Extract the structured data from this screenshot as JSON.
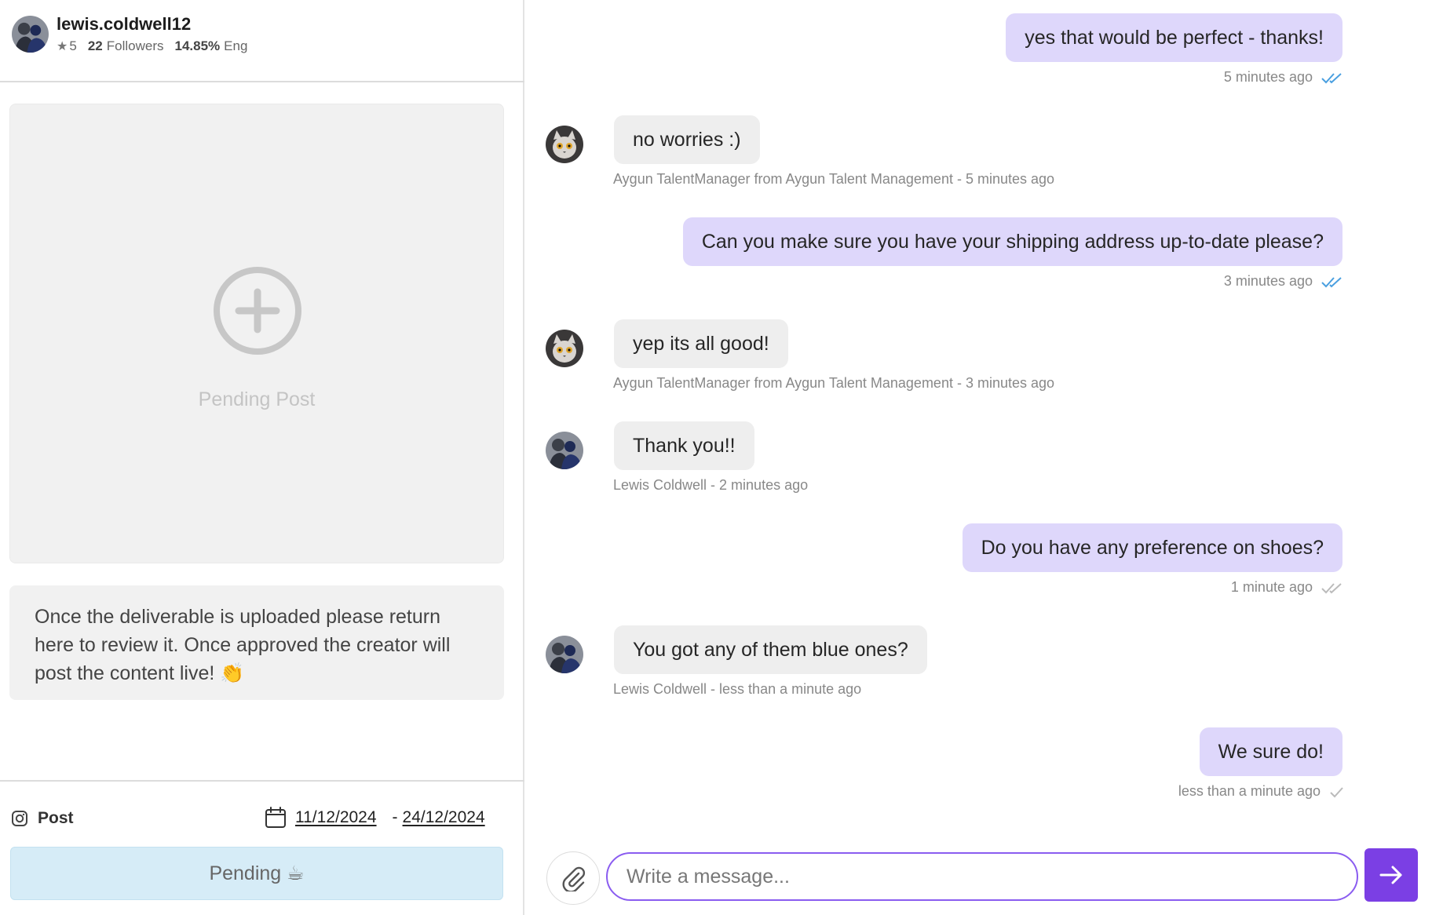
{
  "profile": {
    "username": "lewis.coldwell12",
    "rating": "5",
    "followers_count": "22",
    "followers_label": "Followers",
    "engagement_value": "14.85%",
    "engagement_label": "Eng"
  },
  "deliverable": {
    "placeholder_label": "Pending Post",
    "info_text": "Once the deliverable is uploaded please return here to review it. Once approved the creator will post the content live! 👏",
    "post_type": "Post",
    "start_date": "11/12/2024",
    "date_separator": "-",
    "end_date": "24/12/2024",
    "status_label": "Pending ☕"
  },
  "messages": [
    {
      "direction": "out",
      "text": "yes that would be perfect - thanks!",
      "meta": "5 minutes ago",
      "receipt": "read"
    },
    {
      "direction": "in",
      "text": "no worries :)",
      "meta": "Aygun TalentManager from Aygun Talent Management - 5 minutes ago",
      "avatar": "manager"
    },
    {
      "direction": "out",
      "text": "Can you make sure you have your shipping address up-to-date please?",
      "meta": "3 minutes ago",
      "receipt": "read"
    },
    {
      "direction": "in",
      "text": "yep its all good!",
      "meta": "Aygun TalentManager from Aygun Talent Management - 3 minutes ago",
      "avatar": "manager"
    },
    {
      "direction": "in",
      "text": "Thank you!!",
      "meta": "Lewis Coldwell - 2 minutes ago",
      "avatar": "creator"
    },
    {
      "direction": "out",
      "text": "Do you have any preference on shoes?",
      "meta": "1 minute ago",
      "receipt": "delivered"
    },
    {
      "direction": "in",
      "text": "You got any of them blue ones?",
      "meta": "Lewis Coldwell - less than a minute ago",
      "avatar": "creator"
    },
    {
      "direction": "out",
      "text": "We sure do!",
      "meta": "less than a minute ago",
      "receipt": "sent"
    }
  ],
  "composer": {
    "placeholder": "Write a message..."
  },
  "colors": {
    "outgoing_bubble": "#ded7fb",
    "incoming_bubble": "#eeeeee",
    "accent": "#7b3fe4",
    "status_bg": "#d6ecf7",
    "read_receipt": "#4a9fe0"
  }
}
